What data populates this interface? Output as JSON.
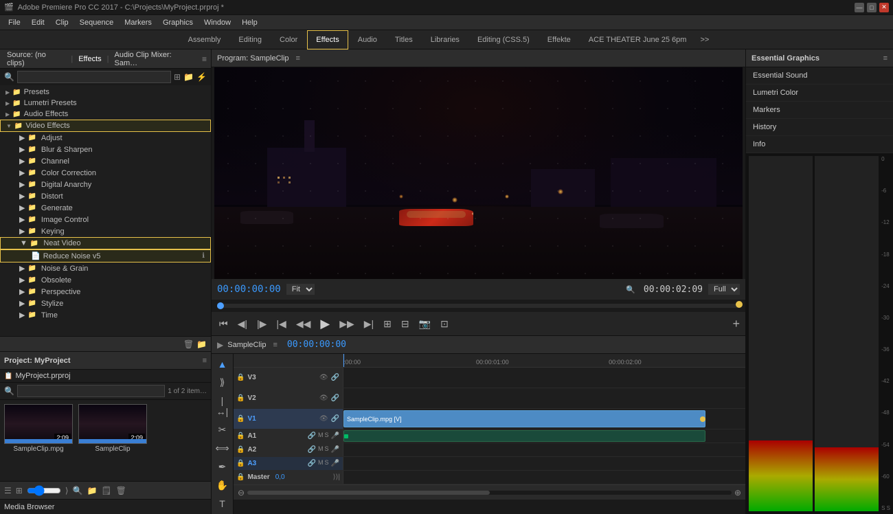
{
  "titleBar": {
    "title": "Adobe Premiere Pro CC 2017 - C:\\Projects\\MyProject.prproj *",
    "appIcon": "🎬",
    "winControls": [
      "—",
      "□",
      "✕"
    ]
  },
  "menuBar": {
    "items": [
      "File",
      "Edit",
      "Clip",
      "Sequence",
      "Markers",
      "Graphics",
      "Window",
      "Help"
    ]
  },
  "workspaceTabs": {
    "tabs": [
      "Assembly",
      "Editing",
      "Color",
      "Effects",
      "Audio",
      "Titles",
      "Libraries",
      "Editing (CSS.5)",
      "Effekte",
      "ACE THEATER June 25 6pm"
    ],
    "activeTab": "Effects",
    "moreLabel": ">>"
  },
  "effectsPanel": {
    "title": "Effects",
    "tabs": [
      "Source: (no clips)",
      "Effects",
      "Audio Clip Mixer: Sam…"
    ],
    "activeTab": "Effects",
    "searchPlaceholder": "",
    "categories": [
      {
        "label": "Presets",
        "type": "category",
        "level": 0
      },
      {
        "label": "Lumetri Presets",
        "type": "category",
        "level": 0
      },
      {
        "label": "Audio Effects",
        "type": "category",
        "level": 0
      },
      {
        "label": "Video Effects",
        "type": "category",
        "level": 0,
        "highlighted": true,
        "expanded": true
      },
      {
        "label": "Adjust",
        "type": "sub",
        "level": 1
      },
      {
        "label": "Blur & Sharpen",
        "type": "sub",
        "level": 1
      },
      {
        "label": "Channel",
        "type": "sub",
        "level": 1
      },
      {
        "label": "Color Correction",
        "type": "sub",
        "level": 1
      },
      {
        "label": "Digital Anarchy",
        "type": "sub",
        "level": 1
      },
      {
        "label": "Distort",
        "type": "sub",
        "level": 1
      },
      {
        "label": "Generate",
        "type": "sub",
        "level": 1
      },
      {
        "label": "Image Control",
        "type": "sub",
        "level": 1
      },
      {
        "label": "Keying",
        "type": "sub",
        "level": 1
      },
      {
        "label": "Neat Video",
        "type": "sub",
        "level": 1,
        "highlighted": true,
        "expanded": true
      },
      {
        "label": "Reduce Noise v5",
        "type": "leaf",
        "level": 2,
        "highlighted": true
      },
      {
        "label": "Noise & Grain",
        "type": "sub",
        "level": 1
      },
      {
        "label": "Obsolete",
        "type": "sub",
        "level": 1
      },
      {
        "label": "Perspective",
        "type": "sub",
        "level": 1
      },
      {
        "label": "Stylize",
        "type": "sub",
        "level": 1
      },
      {
        "label": "Time",
        "type": "sub",
        "level": 1
      }
    ]
  },
  "projectPanel": {
    "title": "Project: MyProject",
    "projectFile": "MyProject.prproj",
    "itemCount": "1 of 2 item…",
    "clips": [
      {
        "label": "SampleClip.mpg",
        "duration": "2:09"
      },
      {
        "label": "SampleClip",
        "duration": "2:09"
      }
    ]
  },
  "mediaBrowser": {
    "label": "Media Browser"
  },
  "programMonitor": {
    "title": "Program: SampleClip",
    "timecode": "00:00:00:00",
    "fit": "Fit",
    "full": "Full",
    "endTimecode": "00:00:02:09",
    "controls": [
      "⏮",
      "◀◀",
      "◀",
      "⏭◀",
      "◀◀",
      "▶",
      "▶▶",
      "◀▶",
      "⊞",
      "⊟",
      "📷",
      "⊡"
    ]
  },
  "timeline": {
    "title": "SampleClip",
    "timecode": "00:00:00:00",
    "rulers": [
      {
        "label": ":00:00",
        "pos": 0
      },
      {
        "label": "00:00:01:00",
        "pos": 33
      },
      {
        "label": "00:00:02:00",
        "pos": 66
      }
    ],
    "tracks": [
      {
        "name": "V3",
        "type": "video"
      },
      {
        "name": "V2",
        "type": "video"
      },
      {
        "name": "V1",
        "type": "video",
        "hasClip": true,
        "clipLabel": "SampleClip.mpg [V]",
        "clipStart": 0,
        "clipWidth": 90
      },
      {
        "name": "A1",
        "type": "audio",
        "extras": "M S"
      },
      {
        "name": "A2",
        "type": "audio",
        "extras": "M S"
      },
      {
        "name": "A3",
        "type": "audio",
        "extras": "M S"
      },
      {
        "name": "Master",
        "type": "audio",
        "timecode": "0,0"
      }
    ]
  },
  "essentialGraphics": {
    "title": "Essential Graphics",
    "items": [
      "Essential Sound",
      "Lumetri Color",
      "Markers",
      "History",
      "Info"
    ]
  },
  "levelMeter": {
    "labels": [
      "0",
      "-6",
      "-12",
      "-18",
      "-24",
      "-30",
      "-36",
      "-42",
      "-48",
      "-54",
      "-60",
      "S  S"
    ]
  }
}
